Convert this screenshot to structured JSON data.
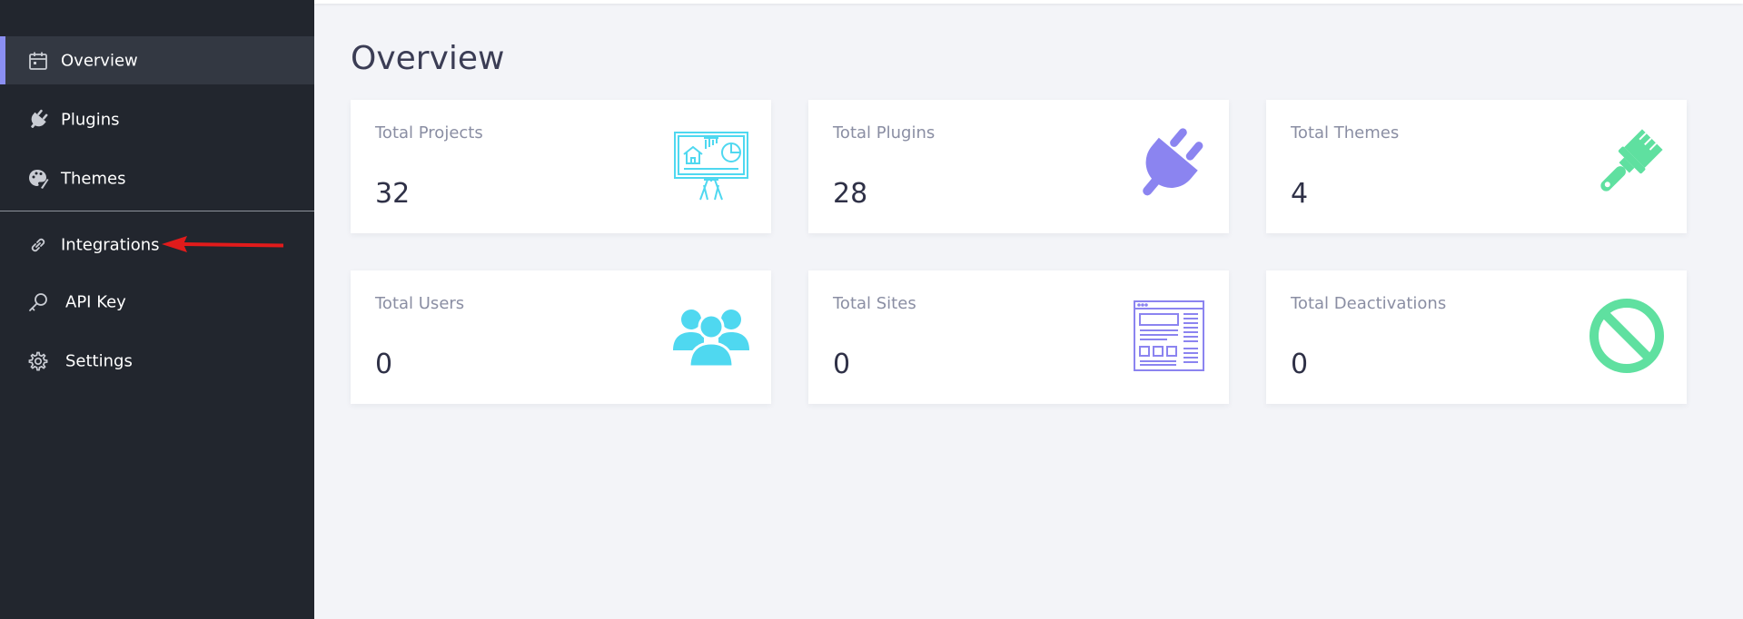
{
  "sidebar": {
    "items": [
      {
        "label": "Overview",
        "icon": "calendar-icon",
        "active": true
      },
      {
        "label": "Plugins",
        "icon": "plug-icon"
      },
      {
        "label": "Themes",
        "icon": "palette-icon"
      },
      {
        "label": "Integrations",
        "icon": "link-icon"
      },
      {
        "label": "API Key",
        "icon": "key-icon"
      },
      {
        "label": "Settings",
        "icon": "gear-icon"
      }
    ]
  },
  "main": {
    "title": "Overview",
    "cards": [
      {
        "label": "Total Projects",
        "value": "32",
        "icon": "presentation-board-icon",
        "color": "#4fd8f0"
      },
      {
        "label": "Total Plugins",
        "value": "28",
        "icon": "plug-icon",
        "color": "#8b84f0"
      },
      {
        "label": "Total Themes",
        "value": "4",
        "icon": "paint-brush-icon",
        "color": "#5fe0a0"
      },
      {
        "label": "Total Users",
        "value": "0",
        "icon": "users-icon",
        "color": "#4fd8f0"
      },
      {
        "label": "Total Sites",
        "value": "0",
        "icon": "website-layout-icon",
        "color": "#8b84f0"
      },
      {
        "label": "Total Deactivations",
        "value": "0",
        "icon": "ban-icon",
        "color": "#5fe0a0"
      }
    ]
  },
  "colors": {
    "sidebar_bg": "#22262e",
    "active_bg": "#333842",
    "accent": "#8b8ff2",
    "annotation_arrow": "#e11b1b"
  }
}
